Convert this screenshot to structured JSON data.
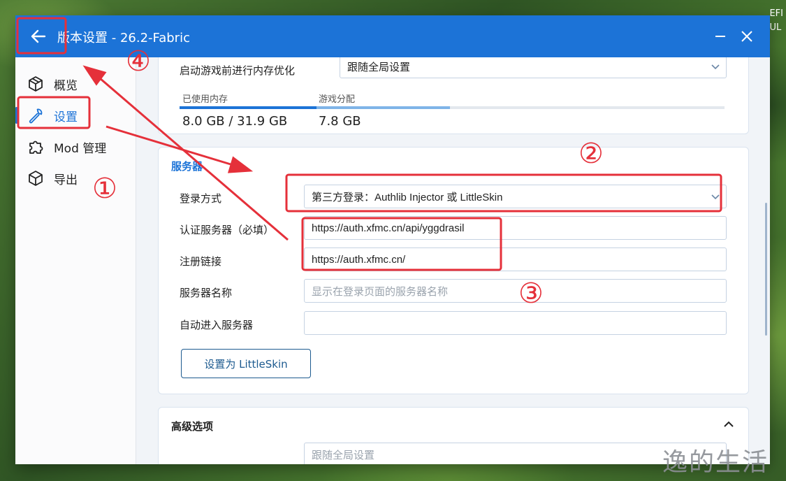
{
  "desktop": {
    "corner_text_1": "EFI",
    "corner_text_2": "UL"
  },
  "window": {
    "title": "版本设置 - 26.2-Fabric",
    "accent_color": "#1c73d7"
  },
  "sidebar": {
    "items": [
      {
        "label": "概览",
        "icon": "cube-icon"
      },
      {
        "label": "设置",
        "icon": "wrench-icon",
        "active": true
      },
      {
        "label": "Mod 管理",
        "icon": "puzzle-icon"
      },
      {
        "label": "导出",
        "icon": "box-icon"
      }
    ]
  },
  "memory": {
    "optimize_label": "启动游戏前进行内存优化",
    "optimize_value": "跟随全局设置",
    "used_label": "已使用内存",
    "used_value": "8.0 GB / 31.9 GB",
    "alloc_label": "游戏分配",
    "alloc_value": "7.8 GB",
    "used_fraction": 0.251,
    "alloc_fraction": 0.245
  },
  "server": {
    "section_title": "服务器",
    "login_label": "登录方式",
    "login_value": "第三方登录：Authlib Injector 或 LittleSkin",
    "auth_label": "认证服务器（必填）",
    "auth_value": "https://auth.xfmc.cn/api/yggdrasil",
    "register_label": "注册链接",
    "register_value": "https://auth.xfmc.cn/",
    "name_label": "服务器名称",
    "name_placeholder": "显示在登录页面的服务器名称",
    "auto_join_label": "自动进入服务器",
    "auto_join_value": "",
    "littleskin_button": "设置为 LittleSkin"
  },
  "advanced": {
    "section_title": "高级选项",
    "field_value": "跟随全局设置"
  },
  "annotations": {
    "n1": "①",
    "n2": "②",
    "n3": "③",
    "n4": "④",
    "color": "#e5303a"
  },
  "watermark": "逸的生活"
}
